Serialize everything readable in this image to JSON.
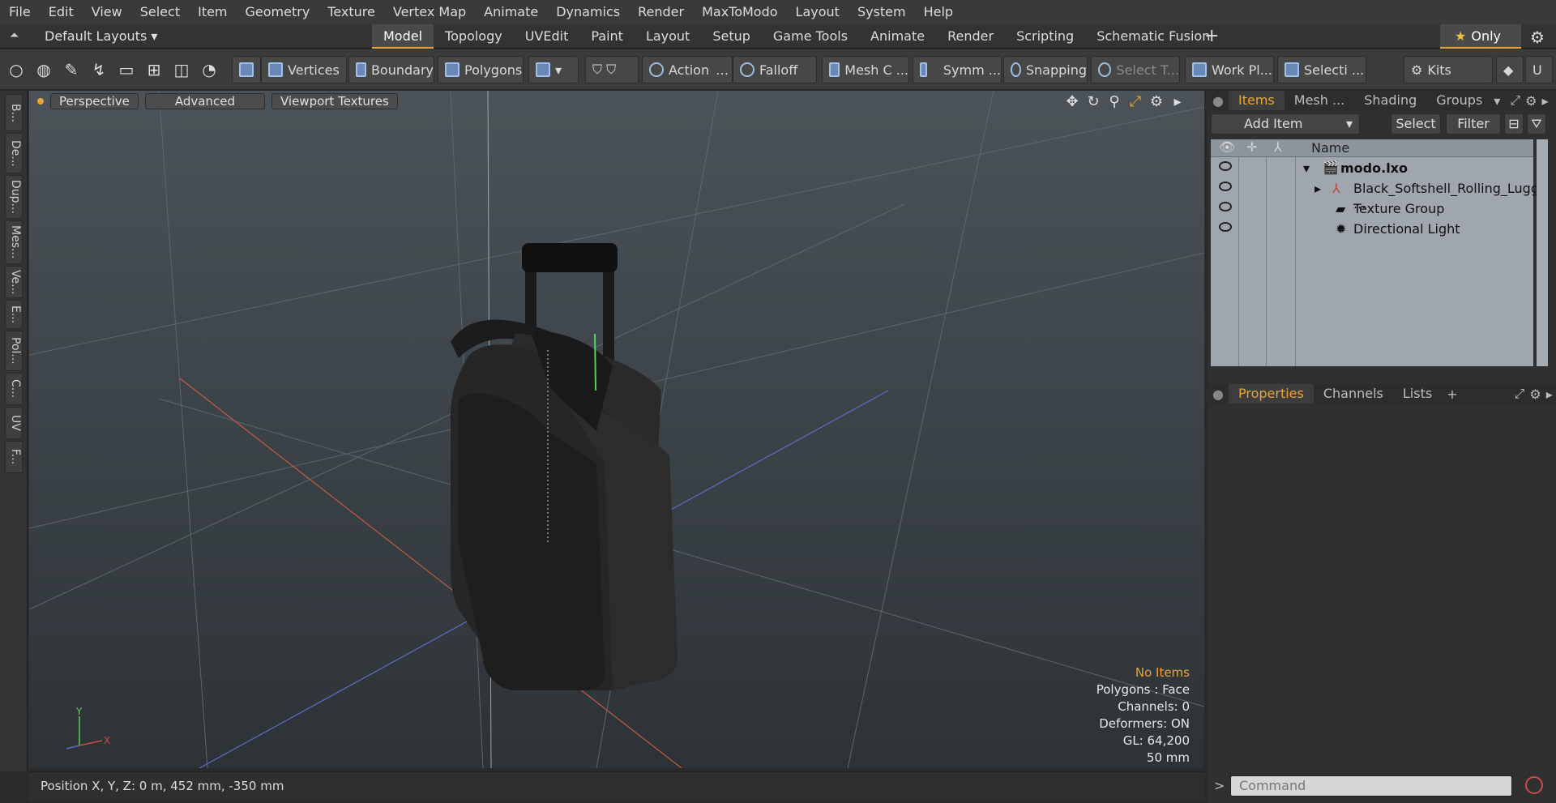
{
  "menu": [
    "File",
    "Edit",
    "View",
    "Select",
    "Item",
    "Geometry",
    "Texture",
    "Vertex Map",
    "Animate",
    "Dynamics",
    "Render",
    "MaxToModo",
    "Layout",
    "System",
    "Help"
  ],
  "layout_bar": {
    "layouts_label": "Default Layouts ▾",
    "tabs": [
      "Model",
      "Topology",
      "UVEdit",
      "Paint",
      "Layout",
      "Setup",
      "Game Tools",
      "Animate",
      "Render",
      "Scripting",
      "Schematic Fusion"
    ],
    "active_tab": "Model",
    "only_label": "Only"
  },
  "toolbar": {
    "vertices": "Vertices",
    "boundary": "Boundary",
    "polygons": "Polygons",
    "action": "Action",
    "falloff": "Falloff",
    "mesh": "Mesh C ...",
    "symm": "Symm ...",
    "snapping": "Snapping",
    "select_t": "Select T...",
    "work_pl": "Work Pl...",
    "selecti": "Selecti ...",
    "kits": "Kits"
  },
  "left_tabs": [
    "B...",
    "De...",
    "Dup...",
    "Mes...",
    "Ve...",
    "E...",
    "Pol...",
    "C...",
    "UV",
    "F..."
  ],
  "viewport": {
    "perspective": "Perspective",
    "advanced": "Advanced",
    "viewport_textures": "Viewport Textures",
    "hud": {
      "no_items": "No Items",
      "polygons": "Polygons : Face",
      "channels": "Channels: 0",
      "deformers": "Deformers: ON",
      "gl": "GL: 64,200",
      "scale": "50 mm"
    }
  },
  "status": {
    "position": "Position X, Y, Z:   0 m, 452 mm, -350 mm"
  },
  "items_panel": {
    "tabs": [
      "Items",
      "Mesh ...",
      "Shading",
      "Groups"
    ],
    "add_item": "Add Item",
    "select": "Select",
    "filter": "Filter",
    "name_header": "Name",
    "rows": [
      "modo.lxo",
      "Black_Softshell_Rolling_Lugg ...",
      "Texture Group",
      "Directional Light"
    ]
  },
  "properties_panel": {
    "tabs": [
      "Properties",
      "Channels",
      "Lists"
    ],
    "command_placeholder": "Command"
  }
}
